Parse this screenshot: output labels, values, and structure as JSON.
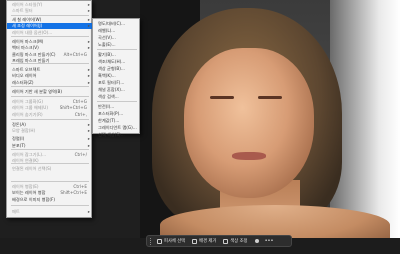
{
  "menu": {
    "items": [
      {
        "label": "레이어 스타일(Y)",
        "shortcut": "",
        "arrow": true,
        "disabled": true
      },
      {
        "label": "스마트 필터",
        "shortcut": "",
        "arrow": true,
        "disabled": true
      },
      {
        "label": "새 칠 레이어(W)",
        "shortcut": "",
        "arrow": true,
        "disabled": false
      },
      {
        "label": "새 조정 레이어(J)",
        "shortcut": "",
        "arrow": true,
        "disabled": false,
        "highlight": true
      },
      {
        "label": "레이어 내용 옵션(O)...",
        "shortcut": "",
        "arrow": false,
        "disabled": true
      },
      {
        "label": "레이어 마스크(M)",
        "shortcut": "",
        "arrow": true,
        "disabled": false
      },
      {
        "label": "벡터 마스크(V)",
        "shortcut": "",
        "arrow": true,
        "disabled": false
      },
      {
        "label": "클리핑 마스크 만들기(C)",
        "shortcut": "Alt+Ctrl+G",
        "arrow": false,
        "disabled": false
      },
      {
        "label": "프레임 마스크 만들기",
        "shortcut": "",
        "arrow": false,
        "disabled": false
      },
      {
        "label": "스마트 오브젝트",
        "shortcut": "",
        "arrow": true,
        "disabled": false
      },
      {
        "label": "비디오 레이어",
        "shortcut": "",
        "arrow": true,
        "disabled": false
      },
      {
        "label": "래스터화(Z)",
        "shortcut": "",
        "arrow": true,
        "disabled": false
      },
      {
        "label": "레이어 기반 새 분할 영역(B)",
        "shortcut": "",
        "arrow": false,
        "disabled": false
      },
      {
        "label": "레이어 그룹화(G)",
        "shortcut": "Ctrl+G",
        "arrow": false,
        "disabled": true
      },
      {
        "label": "레이어 그룹 해제(U)",
        "shortcut": "Shift+Ctrl+G",
        "arrow": false,
        "disabled": true
      },
      {
        "label": "레이어 숨기기(R)",
        "shortcut": "Ctrl+,",
        "arrow": false,
        "disabled": true
      },
      {
        "label": "정돈(A)",
        "shortcut": "",
        "arrow": true,
        "disabled": false
      },
      {
        "label": "모양 결합(H)",
        "shortcut": "",
        "arrow": true,
        "disabled": true
      },
      {
        "label": "정렬(I)",
        "shortcut": "",
        "arrow": true,
        "disabled": false
      },
      {
        "label": "분포(T)",
        "shortcut": "",
        "arrow": true,
        "disabled": false
      },
      {
        "label": "레이어 잠그기(L)...",
        "shortcut": "Ctrl+/",
        "arrow": false,
        "disabled": true
      },
      {
        "label": "레이어 연결(K)",
        "shortcut": "",
        "arrow": false,
        "disabled": true
      },
      {
        "label": "연결된 레이어 선택(S)",
        "shortcut": "",
        "arrow": false,
        "disabled": true
      },
      {
        "label": "레이어 병합(E)",
        "shortcut": "Ctrl+E",
        "arrow": false,
        "disabled": true
      },
      {
        "label": "보이는 레이어 병합",
        "shortcut": "Shift+Ctrl+E",
        "arrow": false,
        "disabled": false
      },
      {
        "label": "배경으로 이미지 병합(F)",
        "shortcut": "",
        "arrow": false,
        "disabled": false
      },
      {
        "label": "매트",
        "shortcut": "",
        "arrow": true,
        "disabled": true
      }
    ]
  },
  "submenu": {
    "items": [
      {
        "label": "명도/대비(C)...",
        "arrow": false
      },
      {
        "label": "레벨(L)...",
        "arrow": false
      },
      {
        "label": "곡선(V)...",
        "arrow": false
      },
      {
        "label": "노출(E)...",
        "arrow": false
      },
      {
        "label": "활기(B)...",
        "arrow": false
      },
      {
        "label": "색조/채도(H)...",
        "arrow": false
      },
      {
        "label": "색상 균형(B)...",
        "arrow": false
      },
      {
        "label": "흑백(K)...",
        "arrow": false
      },
      {
        "label": "포토 필터(F)...",
        "arrow": false
      },
      {
        "label": "채널 혼합(X)...",
        "arrow": false
      },
      {
        "label": "색상 검색...",
        "arrow": false
      },
      {
        "label": "반전(I)...",
        "arrow": false
      },
      {
        "label": "포스터화(P)...",
        "arrow": false
      },
      {
        "label": "한계값(T)...",
        "arrow": false
      },
      {
        "label": "그레이디언트 맵(G)...",
        "arrow": false
      },
      {
        "label": "선택 색상(S)...",
        "arrow": false
      }
    ]
  },
  "context_bar": {
    "select_subject": "피사체 선택",
    "remove_background": "배경 제거",
    "adjust": "색상 조정",
    "more": "•••"
  }
}
